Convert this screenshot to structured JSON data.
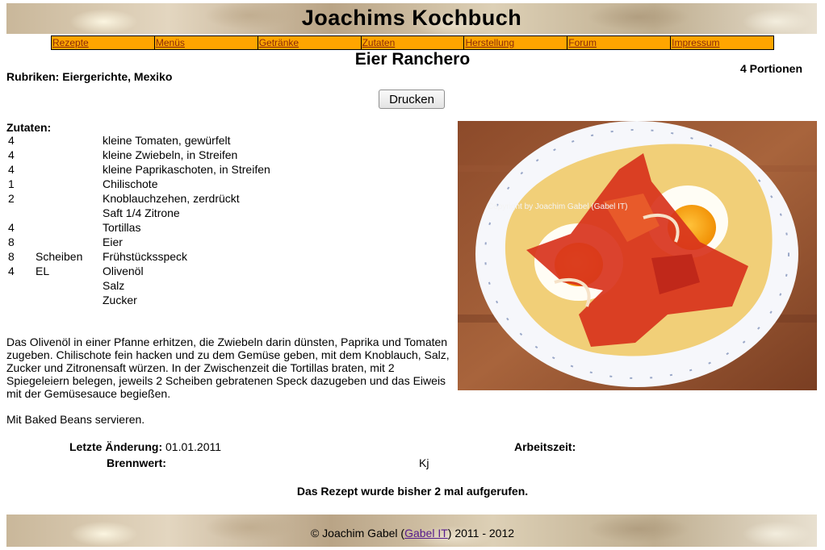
{
  "site": {
    "title": "Joachims Kochbuch"
  },
  "nav": {
    "items": [
      "Rezepte",
      "Menüs",
      "Getränke",
      "Zutaten",
      "Herstellung",
      "Forum",
      "Impressum"
    ]
  },
  "recipe": {
    "title": "Eier Ranchero",
    "rubrics": "Rubriken: Eiergerichte, Mexiko",
    "portions": "4 Portionen",
    "print_label": "Drucken",
    "ingredients_heading": "Zutaten:",
    "ingredients": [
      {
        "qty": "4",
        "unit": "",
        "name": "kleine Tomaten, gewürfelt"
      },
      {
        "qty": "4",
        "unit": "",
        "name": "kleine Zwiebeln, in Streifen"
      },
      {
        "qty": "4",
        "unit": "",
        "name": "kleine Paprikaschoten, in Streifen"
      },
      {
        "qty": "1",
        "unit": "",
        "name": "Chilischote"
      },
      {
        "qty": "2",
        "unit": "",
        "name": "Knoblauchzehen, zerdrückt"
      },
      {
        "qty": "",
        "unit": "",
        "name": "Saft 1/4 Zitrone"
      },
      {
        "qty": "4",
        "unit": "",
        "name": "Tortillas"
      },
      {
        "qty": "8",
        "unit": "",
        "name": "Eier"
      },
      {
        "qty": "8",
        "unit": "Scheiben",
        "name": "Frühstücksspeck"
      },
      {
        "qty": "4",
        "unit": "EL",
        "name": "Olivenöl"
      },
      {
        "qty": "",
        "unit": "",
        "name": "Salz"
      },
      {
        "qty": "",
        "unit": "",
        "name": "Zucker"
      }
    ],
    "photo_copyright": "Copyright by Joachim Gabel (Gabel IT)",
    "instructions": "Das Olivenöl in einer Pfanne erhitzen, die Zwiebeln darin dünsten, Paprika und Tomaten zugeben. Chilischote fein hacken und zu dem Gemüse geben, mit dem Knoblauch, Salz, Zucker und Zitronensaft würzen. In der Zwischenzeit die Tortillas braten, mit 2 Spiegeleiern belegen, jeweils 2 Scheiben gebratenen Speck dazugeben und das Eiweis mit der Gemüsesauce begießen.",
    "serve": "Mit Baked Beans servieren.",
    "last_changed_label": "Letzte Änderung:",
    "last_changed_value": "01.01.2011",
    "work_time_label": "Arbeitszeit:",
    "energy_label": "Brennwert:",
    "energy_unit": "Kj",
    "view_count": "Das Rezept wurde bisher 2 mal aufgerufen."
  },
  "footer": {
    "prefix": "© Joachim Gabel (",
    "link": "Gabel IT",
    "suffix": ") 2011 - 2012"
  }
}
